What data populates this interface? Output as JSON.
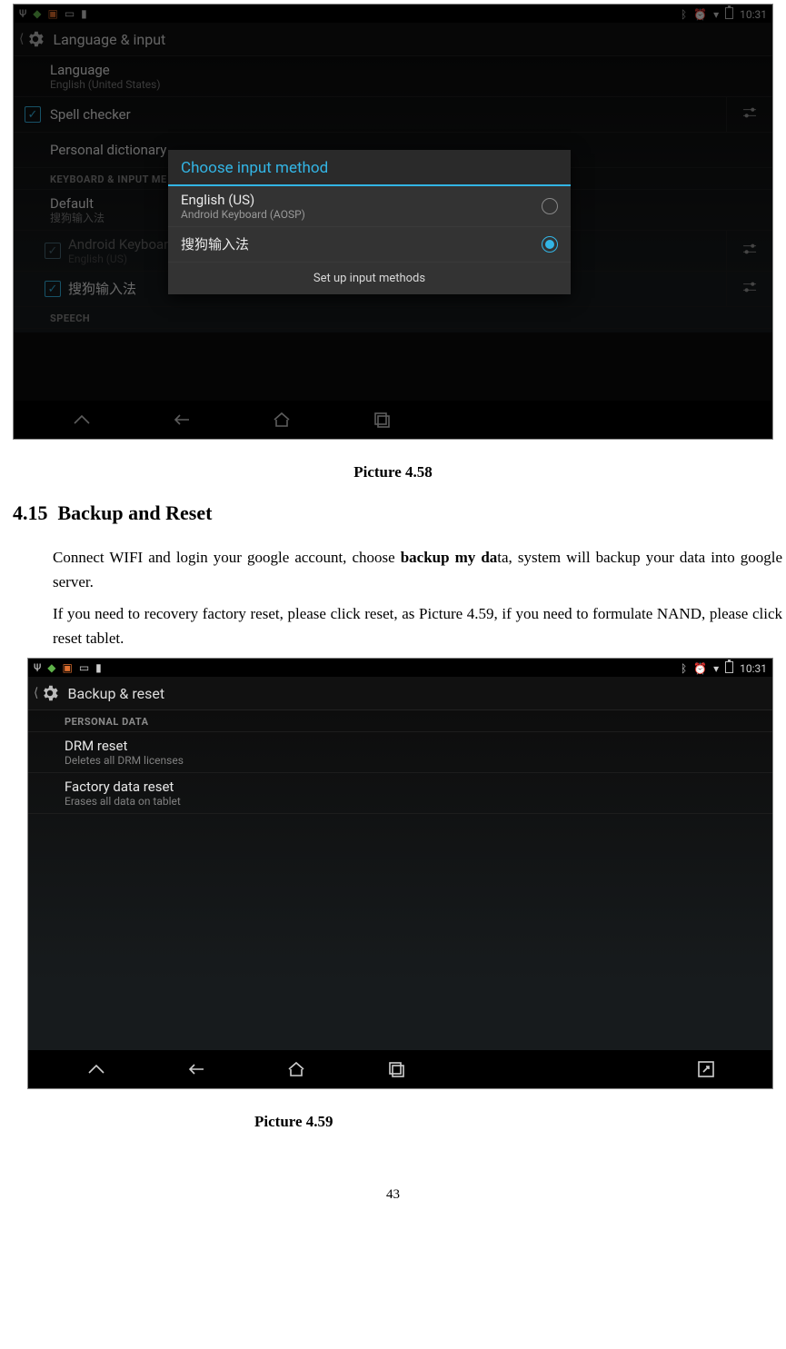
{
  "doc": {
    "caption1": "Picture 4.58",
    "section_number": "4.15",
    "section_title": "Backup and Reset",
    "para1_plain_a": "Connect WIFI and login your google account, choose ",
    "para1_bold": "backup my da",
    "para1_plain_b": "ta, system will backup your data into google server.",
    "para2": "If you need to recovery factory reset, please click reset, as Picture 4.59, if you need to formulate NAND, please click reset tablet.",
    "caption2": "Picture 4.59",
    "page_number": "43"
  },
  "shot1": {
    "status_time": "10:31",
    "appbar_title": "Language & input",
    "items": {
      "language_title": "Language",
      "language_sub": "English (United States)",
      "spell_title": "Spell checker",
      "pdict_title": "Personal dictionary",
      "section_kbd": "KEYBOARD & INPUT METHODS",
      "section_kbd_trunc": "KEYBOARD & INPUT ME",
      "default_title": "Default",
      "default_sub": "搜狗输入法",
      "aosp_title": "Android Keyboard (AOSP)",
      "aosp_sub": "English (US)",
      "sogou_title": "搜狗输入法",
      "section_speech": "SPEECH"
    },
    "modal": {
      "title": "Choose input method",
      "opt1_primary": "English (US)",
      "opt1_secondary": "Android Keyboard (AOSP)",
      "opt2_primary": "搜狗输入法",
      "footer": "Set up input methods"
    }
  },
  "shot2": {
    "status_time": "10:31",
    "appbar_title": "Backup & reset",
    "section_personal": "PERSONAL DATA",
    "drm_title": "DRM reset",
    "drm_sub": "Deletes all DRM licenses",
    "factory_title": "Factory data reset",
    "factory_sub": "Erases all data on tablet"
  }
}
